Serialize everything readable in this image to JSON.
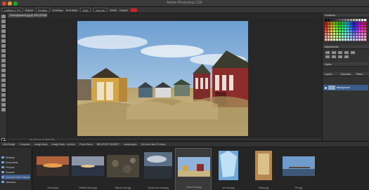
{
  "app": {
    "title": "Adobe Photoshop CS6"
  },
  "options_bar": {
    "items": [
      "Untitled-1 Fit",
      "Adjust",
      "Feather",
      "Unsharp",
      "Anti-alias",
      "Style",
      "Normal",
      "Width",
      "Height"
    ]
  },
  "document": {
    "tab": "Photo@spotch.jpg @ 33% (RGB/8*)"
  },
  "status_bar": {
    "zoom": "33.33%",
    "info": "Doc: 21.5M/21.5M"
  },
  "panels": {
    "tabs": [
      "Swatches",
      "Adjustments",
      "Styles",
      "Layers",
      "Channels",
      "Paths"
    ],
    "layer_name": "Background"
  },
  "bridge": {
    "header": "Mini Bridge",
    "path": [
      "Computer",
      "Image Bank",
      "Image Bank - Archive",
      "Photo Stock",
      "BEACHES SUNSET",
      "Landscapes",
      "Get and Have Fixtures"
    ],
    "folders": [
      "Desktop",
      "Documents",
      "Pictures",
      "Seaside",
      "Get and Have Fixtures",
      "Harbours"
    ],
    "thumbnails": [
      {
        "label": "Sunset.jpg"
      },
      {
        "label": "Pebble sunset.jpg"
      },
      {
        "label": "Beach rocks.jpg"
      },
      {
        "label": "Clouds and rocks.jpg"
      },
      {
        "label": "Beach huts.jpg"
      },
      {
        "label": "Ice cave.jpg"
      },
      {
        "label": "Reeds.jpg"
      },
      {
        "label": "Pier.jpg"
      }
    ]
  }
}
